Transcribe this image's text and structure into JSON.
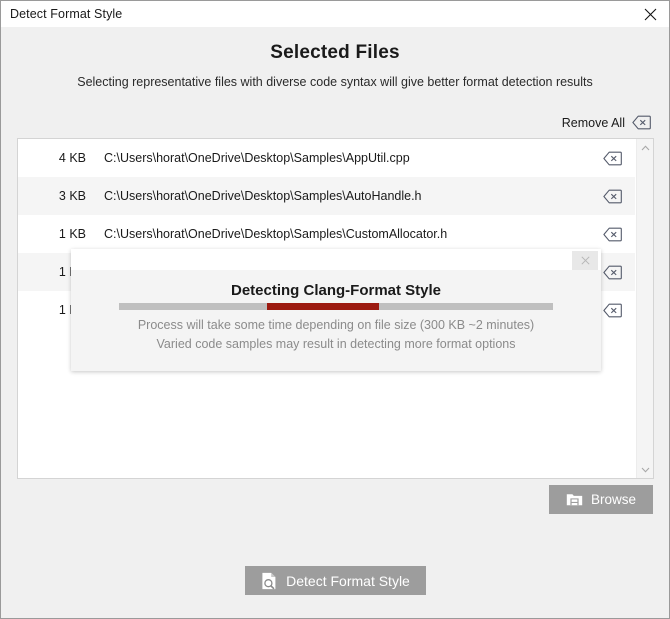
{
  "window": {
    "title": "Detect Format Style",
    "close_icon": "close-icon"
  },
  "header": {
    "title": "Selected Files",
    "subtitle": "Selecting representative files with diverse code syntax will give better format detection results"
  },
  "toolbar": {
    "remove_all_label": "Remove All",
    "remove_all_icon": "backspace-delete-icon"
  },
  "file_list": {
    "rows": [
      {
        "size": "4 KB",
        "path": "C:\\Users\\horat\\OneDrive\\Desktop\\Samples\\AppUtil.cpp",
        "delete_icon": "backspace-delete-icon"
      },
      {
        "size": "3 KB",
        "path": "C:\\Users\\horat\\OneDrive\\Desktop\\Samples\\AutoHandle.h",
        "delete_icon": "backspace-delete-icon"
      },
      {
        "size": "1 KB",
        "path": "C:\\Users\\horat\\OneDrive\\Desktop\\Samples\\CustomAllocator.h",
        "delete_icon": "backspace-delete-icon"
      },
      {
        "size": "1 KB",
        "path": "",
        "delete_icon": "backspace-delete-icon"
      },
      {
        "size": "1 KB",
        "path": "",
        "delete_icon": "backspace-delete-icon"
      }
    ],
    "scrollbar": {
      "up_icon": "chevron-up-icon",
      "down_icon": "chevron-down-icon"
    }
  },
  "browse": {
    "label": "Browse",
    "icon": "folder-icon"
  },
  "detect": {
    "label": "Detect Format Style",
    "icon": "document-search-icon"
  },
  "progress_dialog": {
    "title": "Detecting Clang-Format Style",
    "close_icon": "close-icon",
    "note_line1": "Process will take some time depending on file size (300 KB ~2 minutes)",
    "note_line2": "Varied code samples may result in detecting more format options",
    "progress_percent_start": 34,
    "progress_percent_width": 26,
    "bar_color": "#9c1a10",
    "track_color": "#bfbfbf"
  }
}
